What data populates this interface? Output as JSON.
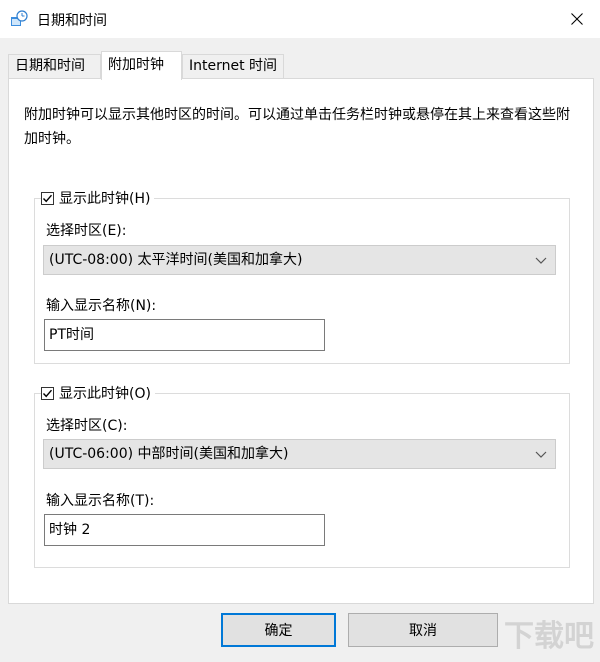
{
  "window": {
    "title": "日期和时间",
    "close_glyph": "✕"
  },
  "tabs": [
    {
      "label": "日期和时间"
    },
    {
      "label": "附加时钟"
    },
    {
      "label": "Internet 时间"
    }
  ],
  "description": "附加时钟可以显示其他时区的时间。可以通过单击任务栏时钟或悬停在其上来查看这些附加时钟。",
  "clock1": {
    "checkbox_label": "显示此时钟(H)",
    "checked": true,
    "timezone_label": "选择时区(E):",
    "timezone_value": "(UTC-08:00) 太平洋时间(美国和加拿大)",
    "name_label": "输入显示名称(N):",
    "name_value": "PT时间"
  },
  "clock2": {
    "checkbox_label": "显示此时钟(O)",
    "checked": true,
    "timezone_label": "选择时区(C):",
    "timezone_value": "(UTC-06:00) 中部时间(美国和加拿大)",
    "name_label": "输入显示名称(T):",
    "name_value": "时钟 2"
  },
  "buttons": {
    "ok": "确定",
    "cancel": "取消"
  },
  "watermark": "下载吧",
  "colors": {
    "accent": "#0078d7",
    "dialog_bg": "#f0f0f0",
    "panel_bg": "#ffffff"
  }
}
